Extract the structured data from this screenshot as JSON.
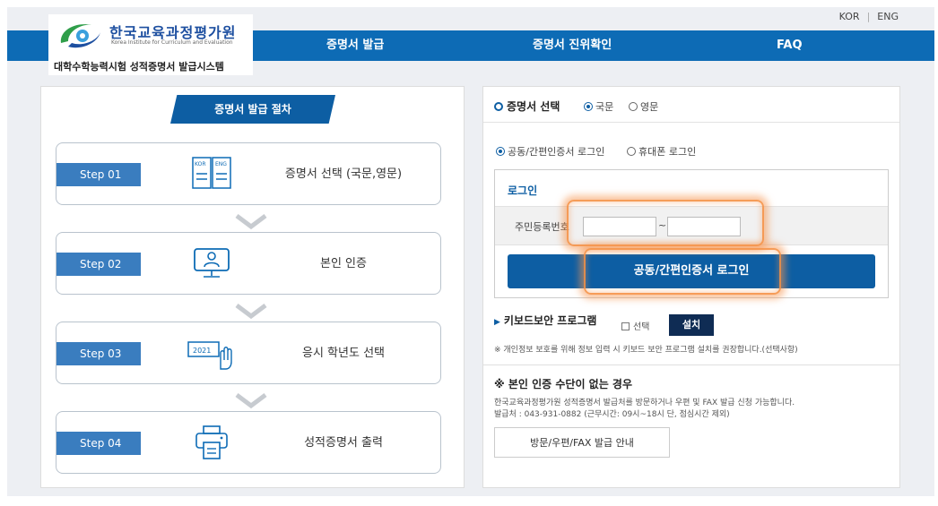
{
  "header": {
    "languages": [
      "KOR",
      "ENG"
    ],
    "logo": {
      "title": "한국교육과정평가원",
      "subtitle": "Korea Institute for Curriculum and Evaluation",
      "system_name": "대학수학능력시험 성적증명서 발급시스템"
    },
    "nav": [
      "증명서 발급",
      "증명서 진위확인",
      "FAQ"
    ],
    "colors": {
      "nav_bg": "#0d6bb5",
      "accent": "#0d5ea3"
    }
  },
  "procedure": {
    "title": "증명서 발급 절차",
    "steps": [
      {
        "tag": "Step 01",
        "text": "증명서 선택 (국문,영문)",
        "icon": "kor-eng-book-icon",
        "icon_labels": [
          "KOR",
          "ENG"
        ]
      },
      {
        "tag": "Step 02",
        "text": "본인 인증",
        "icon": "person-monitor-icon"
      },
      {
        "tag": "Step 03",
        "text": "응시 학년도 선택",
        "icon": "year-select-hand-icon",
        "icon_labels": [
          "2021"
        ]
      },
      {
        "tag": "Step 04",
        "text": "성적증명서 출력",
        "icon": "printer-icon"
      }
    ]
  },
  "cert_select": {
    "title": "증명서 선택",
    "options": [
      "국문",
      "영문"
    ],
    "selected": "국문"
  },
  "login_method": {
    "options": [
      "공동/간편인증서 로그인",
      "휴대폰 로그인"
    ],
    "selected": "공동/간편인증서 로그인"
  },
  "login": {
    "title": "로그인",
    "id_label": "주민등록번호",
    "id_first": "",
    "id_separator": "~",
    "id_second": "",
    "button_label": "공동/간편인증서 로그인"
  },
  "keyboard": {
    "title": "키보드보안 프로그램",
    "checkbox_label": "선택",
    "install_label": "설치",
    "note": "※ 개인정보 보호를 위해 정보 입력 시 키보드 보안 프로그램 설치를 권장합니다.(선택사항)"
  },
  "no_auth": {
    "title": "※ 본인 인증 수단이 없는 경우",
    "line1": "한국교육과정평가원 성적증명서 발급처를 방문하거나 우편 및 FAX 발급 신청 가능합니다.",
    "line2": "발급처 : 043-931-0882 (근무시간: 09시~18시 단, 점심시간 제외)",
    "button_label": "방문/우편/FAX 발급 안내"
  }
}
